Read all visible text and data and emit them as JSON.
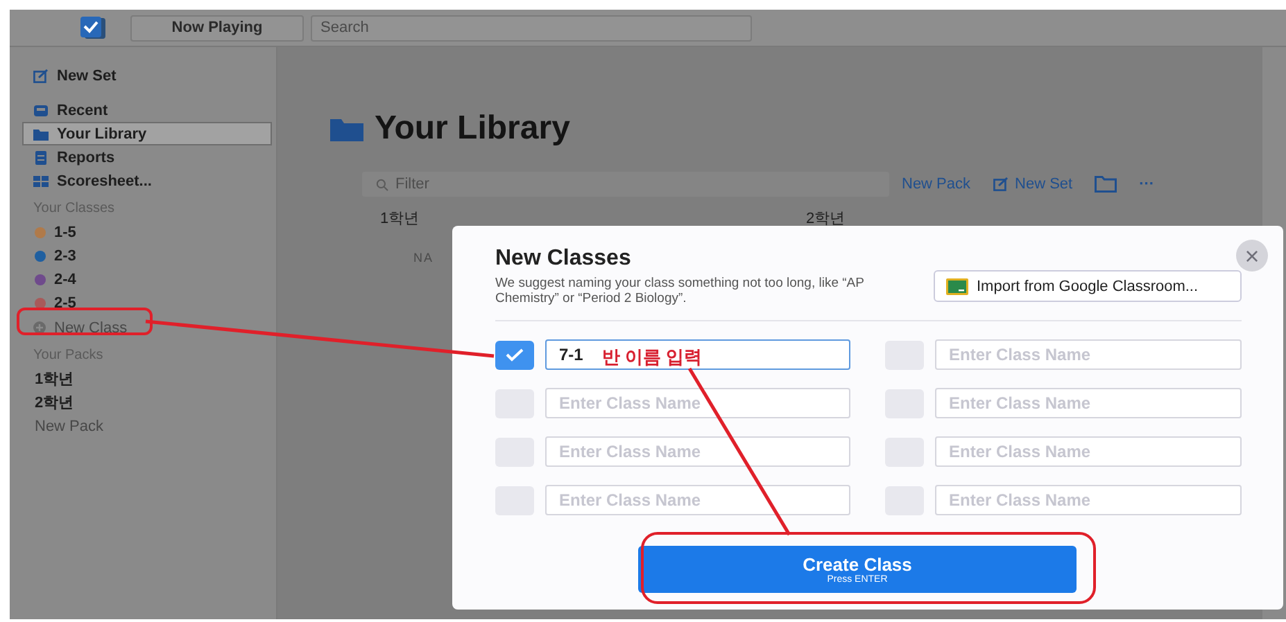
{
  "top_bar": {
    "now_playing": "Now Playing",
    "search_placeholder": "Search"
  },
  "sidebar": {
    "nav": [
      {
        "label": "New Set",
        "selected": false
      },
      {
        "label": "Recent",
        "selected": false
      },
      {
        "label": "Your Library",
        "selected": true
      },
      {
        "label": "Reports",
        "selected": false
      },
      {
        "label": "Scoresheet...",
        "selected": false
      }
    ],
    "classes_heading": "Your Classes",
    "classes": [
      {
        "label": "1-5",
        "color": "#b07a4a"
      },
      {
        "label": "2-3",
        "color": "#1f5fa0"
      },
      {
        "label": "2-4",
        "color": "#6f4a8c"
      },
      {
        "label": "2-5",
        "color": "#a85a5a"
      }
    ],
    "new_class": "New Class",
    "packs_heading": "Your Packs",
    "packs": [
      "1학년",
      "2학년"
    ],
    "new_pack": "New Pack"
  },
  "main": {
    "title": "Your Library",
    "filter_placeholder": "Filter",
    "new_pack": "New Pack",
    "new_set": "New Set",
    "more": "···",
    "packs": [
      "1학년",
      "2학년"
    ],
    "column_1": "NA"
  },
  "modal": {
    "title": "New Classes",
    "description": "We suggest naming your class something not too long, like “AP Chemistry” or “Period 2 Biology”.",
    "import_button": "Import from Google Classroom...",
    "close": "×",
    "rows": [
      {
        "checked": true,
        "value": "7-1"
      },
      {
        "checked": false,
        "value": "",
        "placeholder": "Enter Class Name"
      },
      {
        "checked": false,
        "value": "",
        "placeholder": "Enter Class Name"
      },
      {
        "checked": false,
        "value": "",
        "placeholder": "Enter Class Name"
      },
      {
        "checked": false,
        "value": "",
        "placeholder": "Enter Class Name"
      },
      {
        "checked": false,
        "value": "",
        "placeholder": "Enter Class Name"
      },
      {
        "checked": false,
        "value": "",
        "placeholder": "Enter Class Name"
      },
      {
        "checked": false,
        "value": "",
        "placeholder": "Enter Class Name"
      }
    ],
    "create_button": "Create Class",
    "create_hint": "Press ENTER"
  },
  "annotation": {
    "text": "반 이름 입력"
  }
}
